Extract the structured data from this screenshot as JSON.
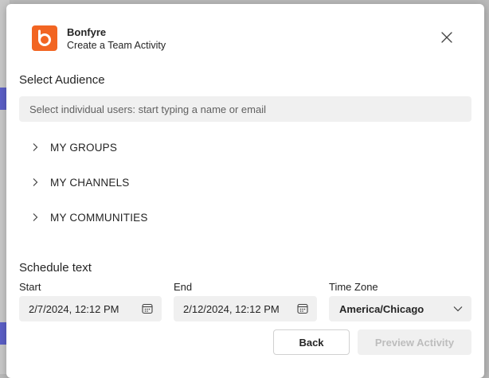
{
  "header": {
    "app_name": "Bonfyre",
    "subtitle": "Create a Team Activity"
  },
  "audience": {
    "title": "Select Audience",
    "search_placeholder": "Select individual users: start typing a name or email",
    "groups": [
      {
        "label": "MY GROUPS"
      },
      {
        "label": "MY CHANNELS"
      },
      {
        "label": "MY COMMUNITIES"
      }
    ]
  },
  "schedule": {
    "title": "Schedule text",
    "start_label": "Start",
    "start_value": "2/7/2024, 12:12 PM",
    "end_label": "End",
    "end_value": "2/12/2024, 12:12 PM",
    "timezone_label": "Time Zone",
    "timezone_value": "America/Chicago"
  },
  "footer": {
    "back_label": "Back",
    "preview_label": "Preview Activity"
  },
  "colors": {
    "brand": "#f26522",
    "field_bg": "#f0f0f0",
    "disabled_text": "#bdbdbd"
  }
}
